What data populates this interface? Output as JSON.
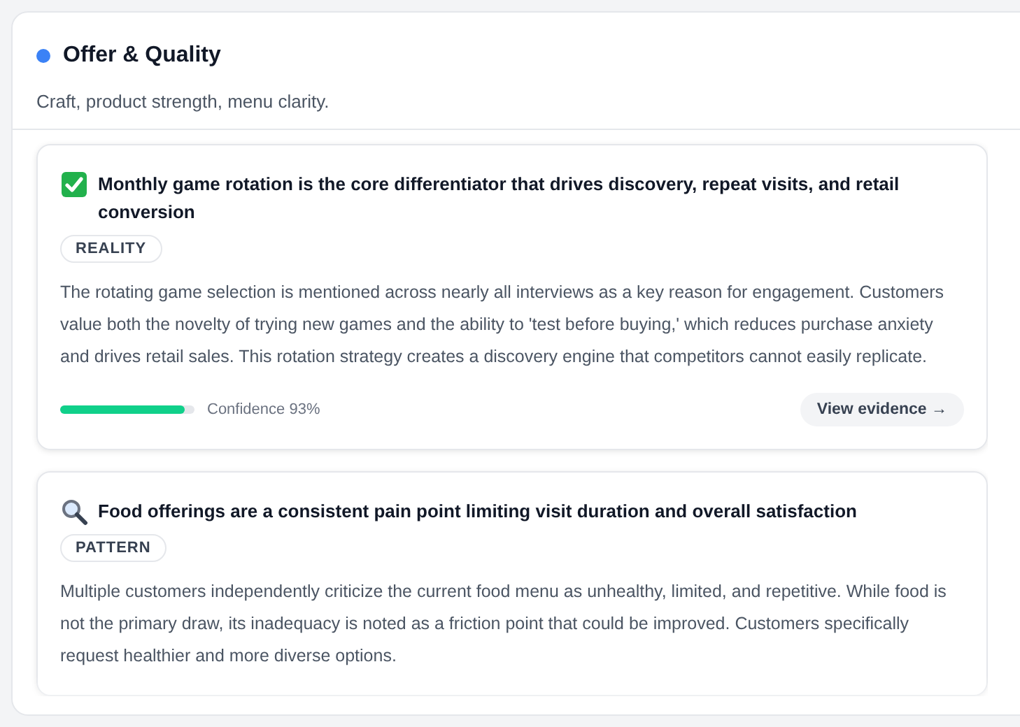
{
  "section": {
    "title": "Offer & Quality",
    "color": "#3b82f6",
    "subtitle": "Craft, product strength, menu clarity."
  },
  "insights": [
    {
      "kind": "check",
      "title": "Monthly game rotation is the core differentiator that drives discovery, repeat visits, and retail conversion",
      "tag": "REALITY",
      "body": "The rotating game selection is mentioned across nearly all interviews as a key reason for engagement. Customers value both the novelty of trying new games and the ability to 'test before buying,' which reduces purchase anxiety and drives retail sales. This rotation strategy creates a discovery engine that competitors cannot easily replicate.",
      "confidence": {
        "level": 0.93,
        "label": "Confidence 93%"
      },
      "action": "View evidence →"
    },
    {
      "kind": "search",
      "title": "Food offerings are a consistent pain point limiting visit duration and overall satisfaction",
      "tag": "PATTERN",
      "body": "Multiple customers independently criticize the current food menu as unhealthy, limited, and repetitive. While food is not the primary draw, its inadequacy is noted as a friction point that could be improved. Customers specifically request healthier and more diverse options."
    }
  ]
}
